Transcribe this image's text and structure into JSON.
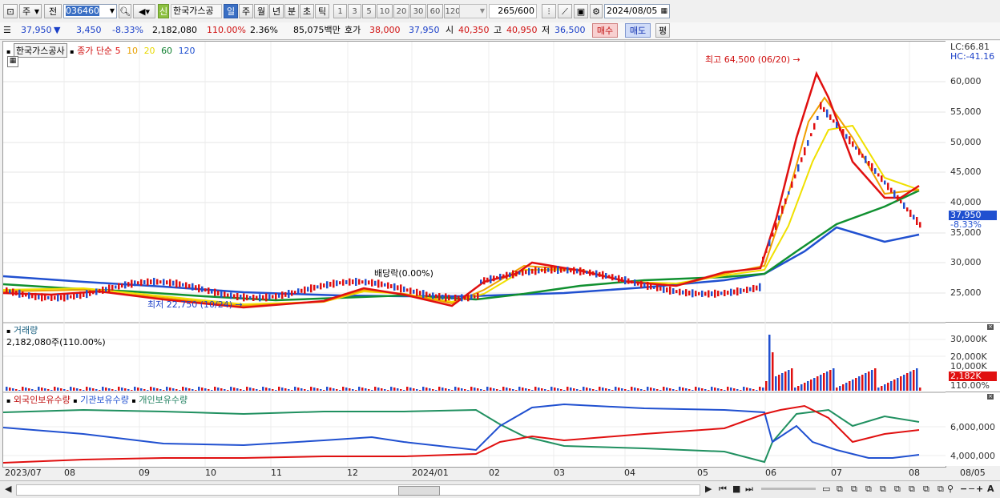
{
  "toolbar": {
    "period_mode": "주",
    "prev_label": "전",
    "stock_code": "036460",
    "badge_new": "신",
    "stock_name": "한국가스공",
    "periods": [
      "일",
      "주",
      "월",
      "년",
      "분",
      "초",
      "틱"
    ],
    "minute_steps": [
      "1",
      "3",
      "5",
      "10",
      "20",
      "30",
      "60",
      "120"
    ],
    "count": "265",
    "count_total": "/600",
    "date": "2024/08/05"
  },
  "quote": {
    "price": "37,950",
    "arrow": "▼",
    "change": "3,450",
    "change_pct": "-8.33%",
    "volume": "2,182,080",
    "volume_ratio": "110.00%",
    "turnover": "2.36%",
    "amount": "85,075백만",
    "bid_label": "호가",
    "bid": "38,000",
    "ask": "37,950",
    "open_label": "시",
    "open": "40,350",
    "high_label": "고",
    "high": "40,950",
    "low_label": "저",
    "low": "36,500",
    "buy_label": "매수",
    "sell_label": "매도",
    "eval_label": "평"
  },
  "price_pane": {
    "title": "한국가스공사",
    "ma_label": "종가 단순",
    "ma_periods": [
      "5",
      "10",
      "20",
      "60",
      "120"
    ],
    "ma_colors": [
      "#e01010",
      "#f0a000",
      "#f0e000",
      "#109030",
      "#2050d0"
    ],
    "lc": "LC:66.81",
    "hc": "HC:-41.16",
    "y_ticks": [
      "60,000",
      "55,000",
      "50,000",
      "45,000",
      "40,000",
      "35,000",
      "30,000",
      "25,000"
    ],
    "current_price": "37,950",
    "current_pct": "-8.33%",
    "max_note": "최고 64,500 (06/20)",
    "min_note": "최저 22,750 (10/24)",
    "dividend_note": "배당락(0.00%)"
  },
  "volume_pane": {
    "title": "거래량",
    "value": "2,182,080주(110.00%)",
    "y_ticks": [
      "30,000K",
      "20,000K",
      "10,000K"
    ],
    "current": "2,182K",
    "current_pct": "110.00%"
  },
  "holding_pane": {
    "series": [
      "외국인보유수량",
      "기관보유수량",
      "개인보유수량"
    ],
    "colors": [
      "#e01010",
      "#2050d0",
      "#209060"
    ],
    "y_ticks": [
      "6,000,000",
      "4,000,000"
    ]
  },
  "x_axis": [
    "2023/07",
    "08",
    "09",
    "10",
    "11",
    "12",
    "2024/01",
    "02",
    "03",
    "04",
    "05",
    "06",
    "07",
    "08",
    "08/05"
  ]
}
